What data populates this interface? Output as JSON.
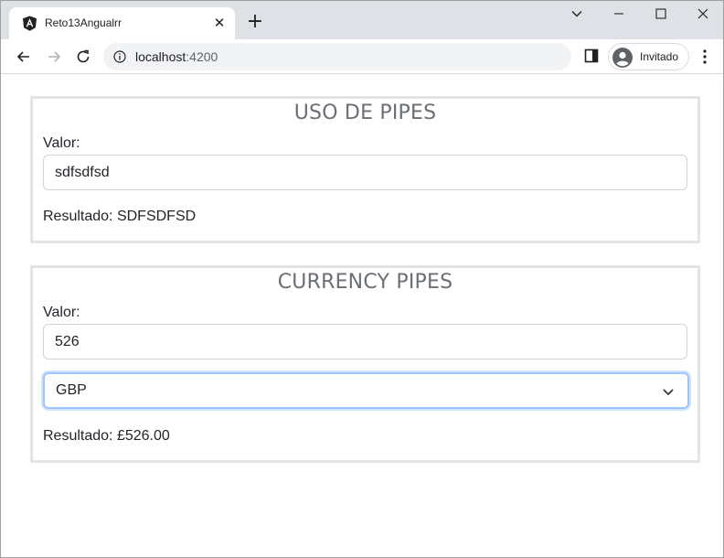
{
  "browser": {
    "tab_title": "Reto13Angualrr",
    "tab_close": "✕",
    "new_tab": "+",
    "url_host": "localhost",
    "url_port": ":4200",
    "profile_label": "Invitado"
  },
  "colors": {
    "tabstrip_bg": "#dee1e6",
    "panel_border": "#e3e4e6",
    "heading": "#6a6f76",
    "select_focus": "#9ec5fe"
  },
  "icons": {
    "tab": "angular-logo-icon",
    "back": "arrow-left-icon",
    "forward": "arrow-right-icon",
    "reload": "reload-icon",
    "info": "info-icon",
    "side_panel": "side-panel-icon",
    "avatar": "avatar-icon",
    "menu": "kebab-menu-icon",
    "minimize": "minimize-icon",
    "maximize": "maximize-icon",
    "close": "close-icon",
    "tab_search": "chevron-down-icon",
    "select": "chevron-down-icon"
  },
  "uso_pipes": {
    "title": "USO DE PIPES",
    "valor_label": "Valor:",
    "input_value": "sdfsdfsd",
    "result": "Resultado: SDFSDFSD"
  },
  "currency_pipes": {
    "title": "CURRENCY PIPES",
    "valor_label": "Valor:",
    "input_value": "526",
    "currency_selected": "GBP",
    "result": "Resultado: £526.00"
  }
}
